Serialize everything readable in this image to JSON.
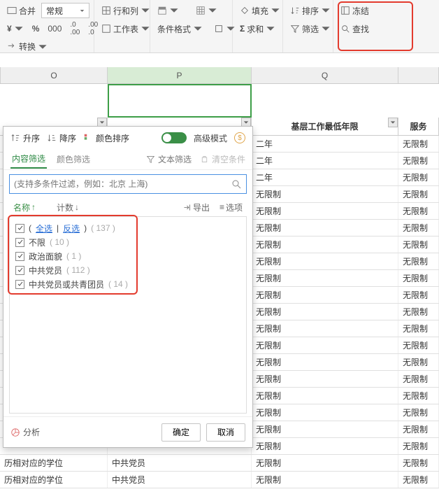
{
  "ribbon": {
    "merge": "合并",
    "num_format": "常规",
    "convert": "转换",
    "rowcol": "行和列",
    "sheet": "工作表",
    "condfmt": "条件格式",
    "fill": "填充",
    "sum": "求和",
    "sort": "排序",
    "filter": "筛选",
    "freeze": "冻结",
    "find": "查找"
  },
  "cols": {
    "O": "O",
    "P": "P",
    "Q": "Q"
  },
  "grid": {
    "header_Q": "基层工作最低年限",
    "header_R": "服务",
    "rows": [
      {
        "O": "",
        "P": "",
        "Q": "二年",
        "R": "无限制"
      },
      {
        "O": "",
        "P": "",
        "Q": "二年",
        "R": "无限制"
      },
      {
        "O": "",
        "P": "",
        "Q": "二年",
        "R": "无限制"
      },
      {
        "O": "",
        "P": "",
        "Q": "无限制",
        "R": "无限制"
      },
      {
        "O": "",
        "P": "",
        "Q": "无限制",
        "R": "无限制"
      },
      {
        "O": "",
        "P": "",
        "Q": "无限制",
        "R": "无限制"
      },
      {
        "O": "",
        "P": "",
        "Q": "无限制",
        "R": "无限制"
      },
      {
        "O": "",
        "P": "",
        "Q": "无限制",
        "R": "无限制"
      },
      {
        "O": "",
        "P": "",
        "Q": "无限制",
        "R": "无限制"
      },
      {
        "O": "",
        "P": "",
        "Q": "无限制",
        "R": "无限制"
      },
      {
        "O": "",
        "P": "",
        "Q": "无限制",
        "R": "无限制"
      },
      {
        "O": "",
        "P": "",
        "Q": "无限制",
        "R": "无限制"
      },
      {
        "O": "",
        "P": "",
        "Q": "无限制",
        "R": "无限制"
      },
      {
        "O": "",
        "P": "",
        "Q": "无限制",
        "R": "无限制"
      },
      {
        "O": "",
        "P": "",
        "Q": "无限制",
        "R": "无限制"
      },
      {
        "O": "",
        "P": "",
        "Q": "无限制",
        "R": "无限制"
      },
      {
        "O": "",
        "P": "",
        "Q": "无限制",
        "R": "无限制"
      },
      {
        "O": "",
        "P": "",
        "Q": "无限制",
        "R": "无限制"
      },
      {
        "O": "",
        "P": "",
        "Q": "无限制",
        "R": "无限制"
      },
      {
        "O": "历相对应的学位",
        "P": "中共党员",
        "Q": "无限制",
        "R": "无限制"
      },
      {
        "O": "历相对应的学位",
        "P": "中共党员",
        "Q": "无限制",
        "R": "无限制"
      }
    ]
  },
  "panel": {
    "asc": "升序",
    "desc": "降序",
    "color_sort": "颜色排序",
    "adv": "高级模式",
    "tab_content": "内容筛选",
    "tab_color": "颜色筛选",
    "text_filter": "文本筛选",
    "clear": "清空条件",
    "search_placeholder": "(支持多条件过滤，例如：北京 上海)",
    "col_name": "名称",
    "col_count": "计数",
    "export": "导出",
    "options": "选项",
    "items": {
      "all_label_open": "(",
      "select_all": "全选",
      "invert": "反选",
      "all_count": "( 137 )",
      "r1_label": "不限",
      "r1_count": "( 10 )",
      "r2_label": "政治面貌",
      "r2_count": "( 1 )",
      "r3_label": "中共党员",
      "r3_count": "( 112 )",
      "r4_label": "中共党员或共青团员",
      "r4_count": "( 14 )"
    },
    "analysis": "分析",
    "ok": "确定",
    "cancel": "取消"
  }
}
